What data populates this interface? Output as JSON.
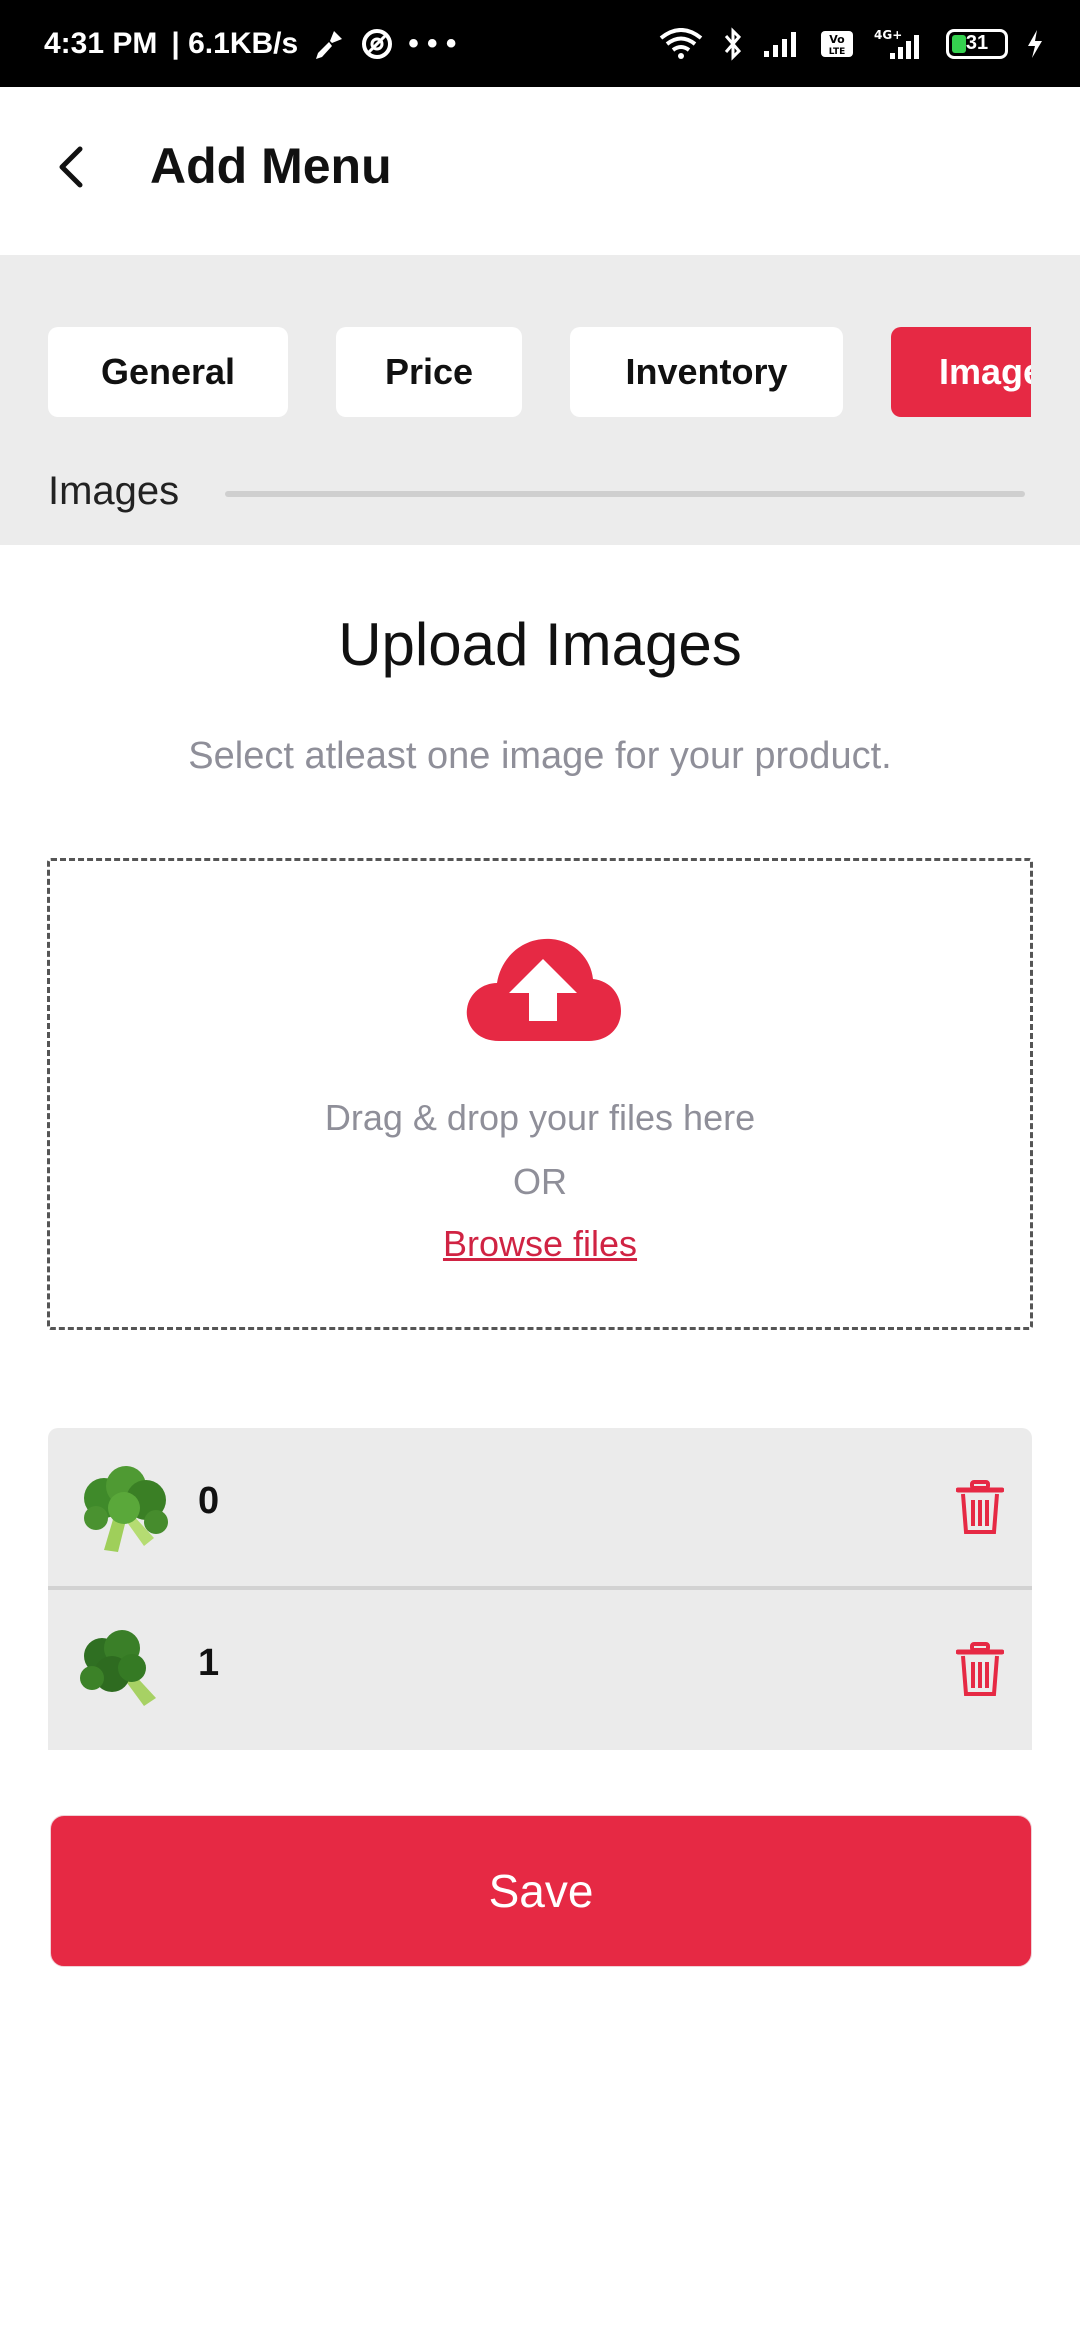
{
  "status_bar": {
    "time": "4:31 PM",
    "speed": "| 6.1KB/s",
    "dots": "• • •",
    "battery": "31",
    "icons": [
      "broom-icon",
      "at-icon",
      "wifi-icon",
      "bluetooth-icon",
      "signal-icon",
      "volte-icon",
      "signal-4g-icon",
      "battery-icon",
      "charging-icon"
    ]
  },
  "header": {
    "title": "Add Menu",
    "back_icon": "back-arrow-icon"
  },
  "tabs": [
    {
      "label": "General",
      "active": false
    },
    {
      "label": "Price",
      "active": false
    },
    {
      "label": "Inventory",
      "active": false
    },
    {
      "label": "Images",
      "active": true
    }
  ],
  "progress": {
    "label": "Images",
    "value": 0
  },
  "upload": {
    "title": "Upload Images",
    "subtitle": "Select atleast one image for your product.",
    "icon": "cloud-upload-icon",
    "drop_text": "Drag & drop your files here",
    "or_text": "OR",
    "browse_label": "Browse files"
  },
  "images": [
    {
      "label": "0",
      "thumb": "broccoli-image",
      "action_icon": "trash-icon"
    },
    {
      "label": "1",
      "thumb": "broccoli-image",
      "action_icon": "trash-icon"
    }
  ],
  "save_label": "Save",
  "colors": {
    "accent": "#e62944",
    "muted_text": "#8f8f99",
    "panel_bg": "#ececec"
  }
}
